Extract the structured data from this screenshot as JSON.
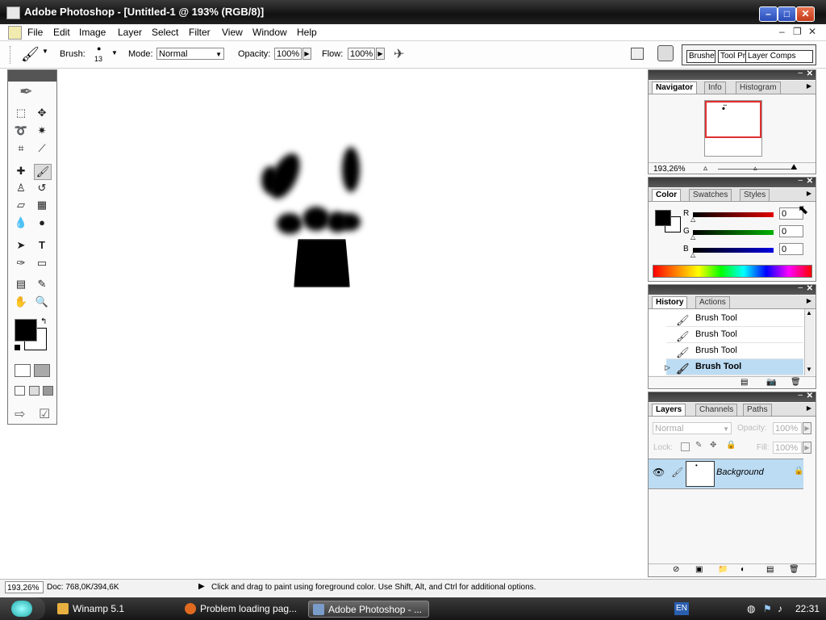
{
  "window": {
    "title": "Adobe Photoshop - [Untitled-1 @ 193% (RGB/8)]",
    "buttons": {
      "minimize": "–",
      "maximize": "□",
      "close": "✕"
    }
  },
  "menu": {
    "items": [
      "File",
      "Edit",
      "Image",
      "Layer",
      "Select",
      "Filter",
      "View",
      "Window",
      "Help"
    ],
    "doc_controls": {
      "minimize": "–",
      "restore": "❐",
      "close": "✕"
    }
  },
  "options": {
    "brush_label": "Brush:",
    "brush_size": "13",
    "mode_label": "Mode:",
    "mode_value": "Normal",
    "opacity_label": "Opacity:",
    "opacity_value": "100%",
    "flow_label": "Flow:",
    "flow_value": "100%",
    "well_tabs": [
      "Brushes",
      "Tool Presets",
      "Layer Comps"
    ]
  },
  "navigator": {
    "tabs": [
      "Navigator",
      "Info",
      "Histogram"
    ],
    "zoom": "193,26%"
  },
  "color": {
    "tabs": [
      "Color",
      "Swatches",
      "Styles"
    ],
    "channels": [
      {
        "label": "R",
        "value": "0"
      },
      {
        "label": "G",
        "value": "0"
      },
      {
        "label": "B",
        "value": "0"
      }
    ],
    "colors": {
      "foreground": "#000000",
      "background": "#ffffff",
      "r_bar": "#e00000",
      "g_bar": "#00b000",
      "b_bar": "#0000e0"
    }
  },
  "history": {
    "tabs": [
      "History",
      "Actions"
    ],
    "items": [
      "Brush Tool",
      "Brush Tool",
      "Brush Tool",
      "Brush Tool"
    ],
    "selected_index": 3
  },
  "layers": {
    "tabs": [
      "Layers",
      "Channels",
      "Paths"
    ],
    "blend_mode": "Normal",
    "opacity_label": "Opacity:",
    "opacity_value": "100%",
    "lock_label": "Lock:",
    "fill_label": "Fill:",
    "fill_value": "100%",
    "layer_name": "Background"
  },
  "status": {
    "zoom": "193,26%",
    "doc": "Doc: 768,0K/394,6K",
    "hint": "Click and drag to paint using foreground color.  Use Shift, Alt, and Ctrl for additional options."
  },
  "taskbar": {
    "items": [
      {
        "label": "Winamp 5.1",
        "icon": "winamp-icon"
      },
      {
        "label": "Problem loading pag...",
        "icon": "firefox-icon"
      },
      {
        "label": "Adobe Photoshop - ...",
        "icon": "photoshop-icon"
      }
    ],
    "language": "EN",
    "clock": "22:31"
  }
}
